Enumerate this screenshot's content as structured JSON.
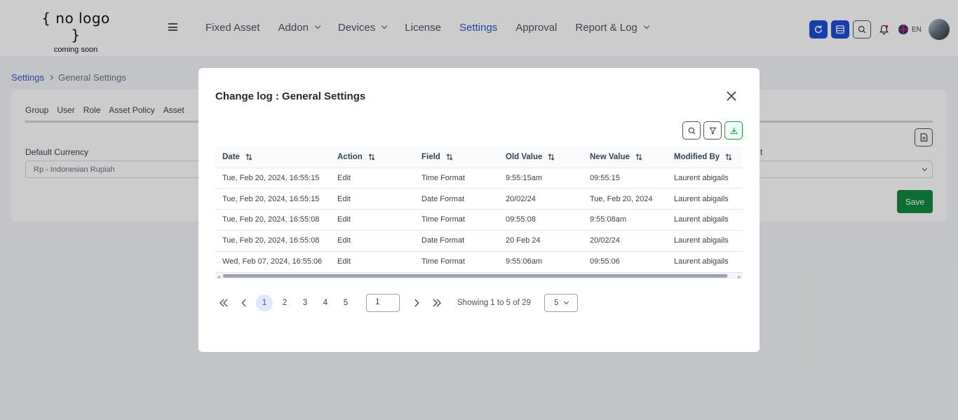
{
  "logo": {
    "main": "{ no logo }",
    "sub": "coming soon"
  },
  "nav": {
    "items": [
      {
        "label": "Fixed Asset",
        "dropdown": false,
        "active": false
      },
      {
        "label": "Addon",
        "dropdown": true,
        "active": false
      },
      {
        "label": "Devices",
        "dropdown": true,
        "active": false
      },
      {
        "label": "License",
        "dropdown": false,
        "active": false
      },
      {
        "label": "Settings",
        "dropdown": false,
        "active": true
      },
      {
        "label": "Approval",
        "dropdown": false,
        "active": false
      },
      {
        "label": "Report & Log",
        "dropdown": true,
        "active": false
      }
    ]
  },
  "header": {
    "language": "EN",
    "icons": [
      "refresh-icon",
      "list-icon",
      "search-icon",
      "bell-icon",
      "uk-flag-icon",
      "avatar"
    ]
  },
  "breadcrumb": {
    "parent": "Settings",
    "current": "General Settings"
  },
  "settings_page": {
    "tabs": [
      "Group",
      "User",
      "Role",
      "Asset Policy",
      "Asset"
    ],
    "currency_label": "Default Currency",
    "currency_value": "Rp - Indonesian Rupiah",
    "right_label_fragment": "t",
    "save_label": "Save"
  },
  "modal": {
    "title": "Change log : General Settings",
    "columns": [
      "Date",
      "Action",
      "Field",
      "Old Value",
      "New Value",
      "Modified By"
    ],
    "rows": [
      [
        "Tue, Feb 20, 2024, 16:55:15",
        "Edit",
        "Time Format",
        "9:55:15am",
        "09:55:15",
        "Laurent abigails"
      ],
      [
        "Tue, Feb 20, 2024, 16:55:15",
        "Edit",
        "Date Format",
        "20/02/24",
        "Tue, Feb 20, 2024",
        "Laurent abigails"
      ],
      [
        "Tue, Feb 20, 2024, 16:55:08",
        "Edit",
        "Time Format",
        "09:55:08",
        "9:55:08am",
        "Laurent abigails"
      ],
      [
        "Tue, Feb 20, 2024, 16:55:08",
        "Edit",
        "Date Format",
        "20 Feb 24",
        "20/02/24",
        "Laurent abigails"
      ],
      [
        "Wed, Feb 07, 2024, 16:55:06",
        "Edit",
        "Time Format",
        "9:55:06am",
        "09:55:06",
        "Laurent abigails"
      ]
    ],
    "pagination": {
      "pages": [
        "1",
        "2",
        "3",
        "4",
        "5"
      ],
      "current_page": "1",
      "goto_value": "1",
      "info": "Showing 1 to 5 of 29",
      "page_size": "5"
    }
  },
  "colors": {
    "primary": "#1d4fd8",
    "active_nav": "#2c57d4",
    "save": "#0f8a3c",
    "export": "#16a34a"
  }
}
